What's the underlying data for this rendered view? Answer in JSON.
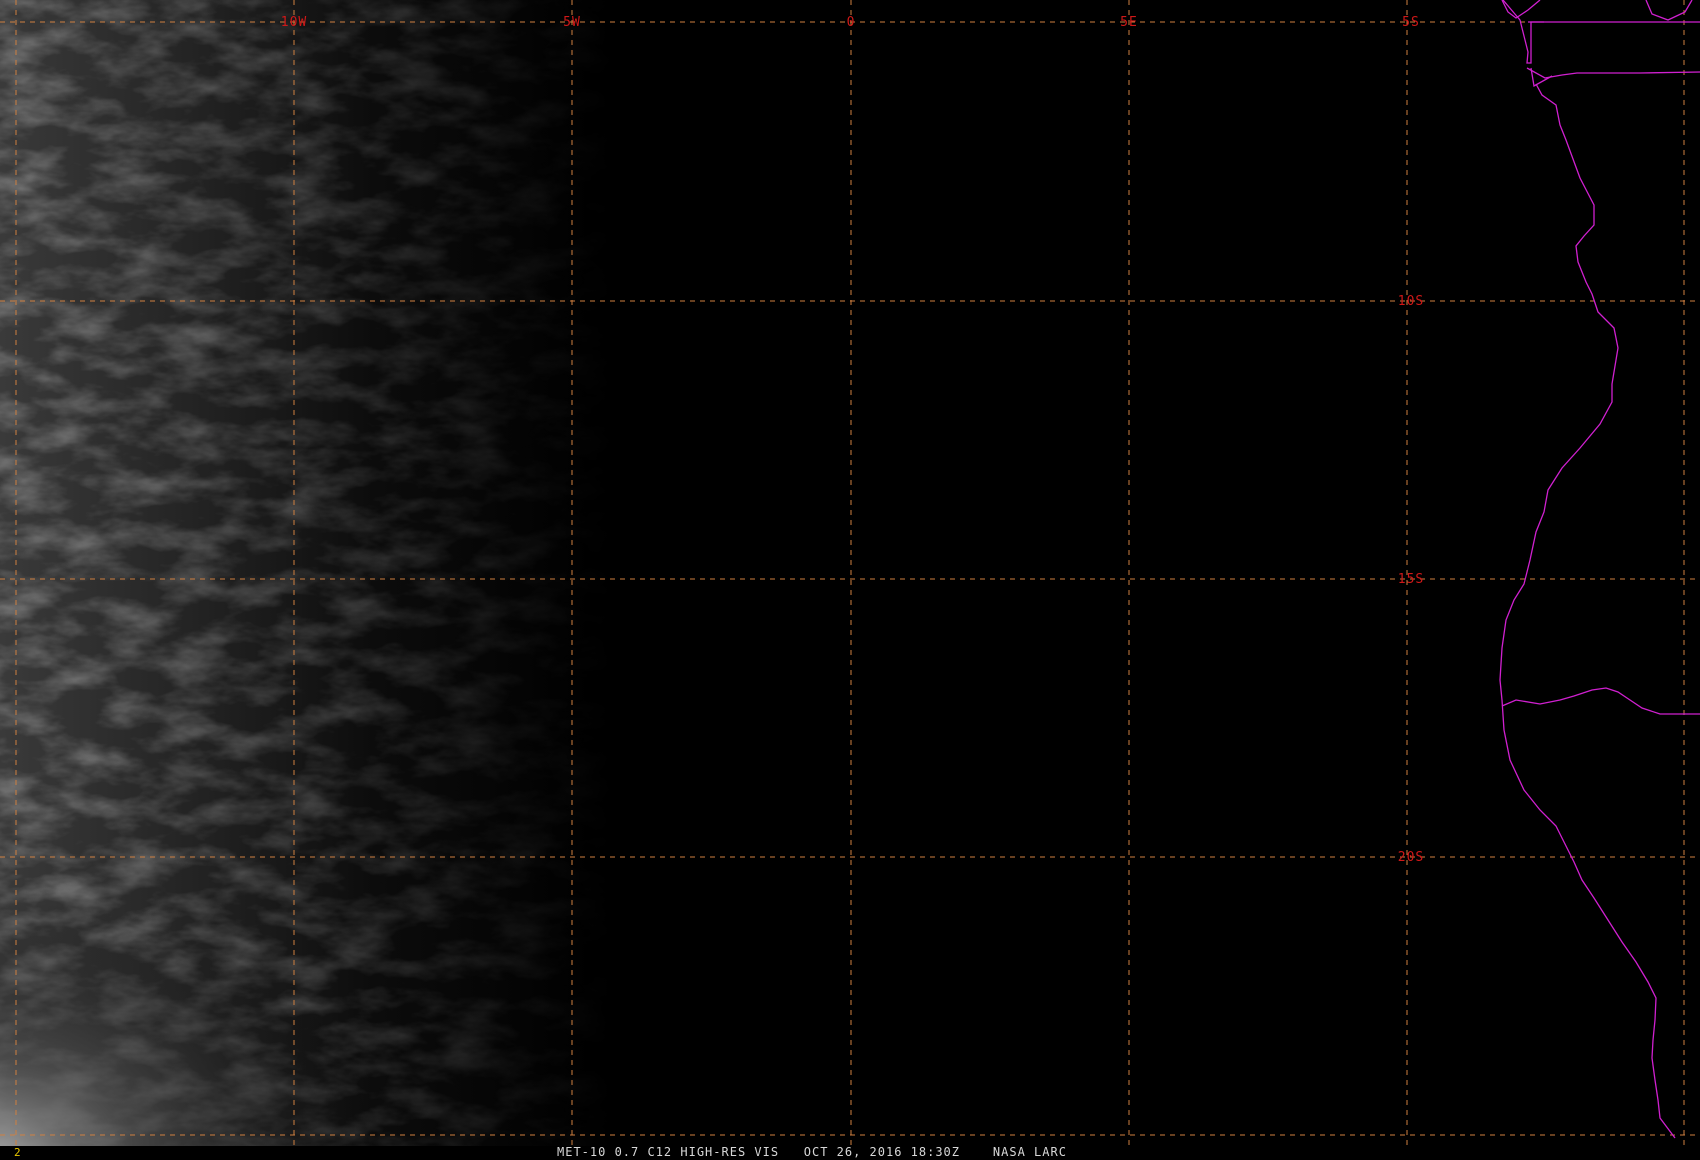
{
  "map": {
    "longitude_labels": [
      "10W",
      "5W",
      "0",
      "5E"
    ],
    "latitude_labels": [
      "5S",
      "10S",
      "15S",
      "20S"
    ],
    "colors": {
      "grid": "#d08040",
      "labels": "#d01818",
      "coastline": "#d020d0",
      "background": "#000000"
    },
    "imagery": "visible satellite imagery, night-side dark with faint clouds in the west and south-west"
  },
  "status_bar": {
    "frame": "2",
    "caption": "MET-10 0.7 C12 HIGH-RES VIS   OCT 26, 2016 18:30Z    NASA LARC"
  }
}
